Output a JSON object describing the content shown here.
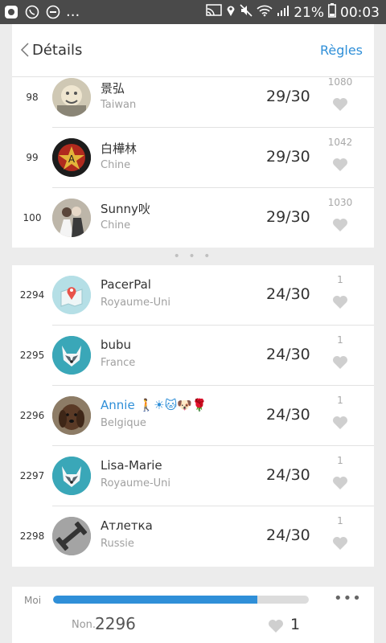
{
  "status_bar": {
    "dots": "...",
    "battery": "21%",
    "time": "00:03"
  },
  "header": {
    "title": "Détails",
    "rules": "Règles"
  },
  "top_rows": [
    {
      "rank": "98",
      "name": "景弘",
      "country": "Taiwan",
      "score": "29/30",
      "likes": "1080"
    },
    {
      "rank": "99",
      "name": "白樺林",
      "country": "Chine",
      "score": "29/30",
      "likes": "1042"
    },
    {
      "rank": "100",
      "name": "Sunny吙",
      "country": "Chine",
      "score": "29/30",
      "likes": "1030"
    }
  ],
  "separator_dots": "• • •",
  "bottom_rows": [
    {
      "rank": "2294",
      "name": "PacerPal",
      "country": "Royaume-Uni",
      "score": "24/30",
      "likes": "1"
    },
    {
      "rank": "2295",
      "name": "bubu",
      "country": "France",
      "score": "24/30",
      "likes": "1"
    },
    {
      "rank": "2296",
      "name": "Annie",
      "emojis": "🚶☀🐱🐶🌹",
      "country": "Belgique",
      "score": "24/30",
      "likes": "1"
    },
    {
      "rank": "2297",
      "name": "Lisa-Marie",
      "country": "Royaume-Uni",
      "score": "24/30",
      "likes": "1"
    },
    {
      "rank": "2298",
      "name": "Атлетка",
      "country": "Russie",
      "score": "24/30",
      "likes": "1"
    }
  ],
  "footer": {
    "label": "Moi",
    "progress": 0.8,
    "more": "•••",
    "rank_prefix": "Non.",
    "rank": "2296",
    "likes": "1"
  },
  "colors": {
    "accent": "#2f8fd8",
    "status_bar": "#4a4a4a"
  }
}
